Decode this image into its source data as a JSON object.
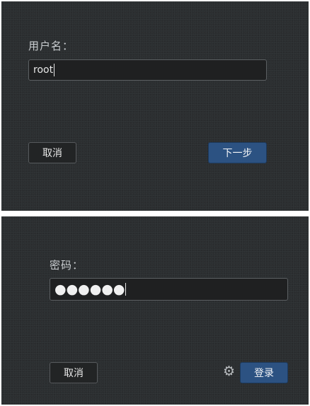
{
  "username_step": {
    "label": "用户名：",
    "value": "root",
    "cancel_label": "取消",
    "next_label": "下一步"
  },
  "password_step": {
    "label": "密码：",
    "masked_value": "●●●●●●",
    "cancel_label": "取消",
    "login_label": "登录",
    "settings_icon": "⚙"
  }
}
